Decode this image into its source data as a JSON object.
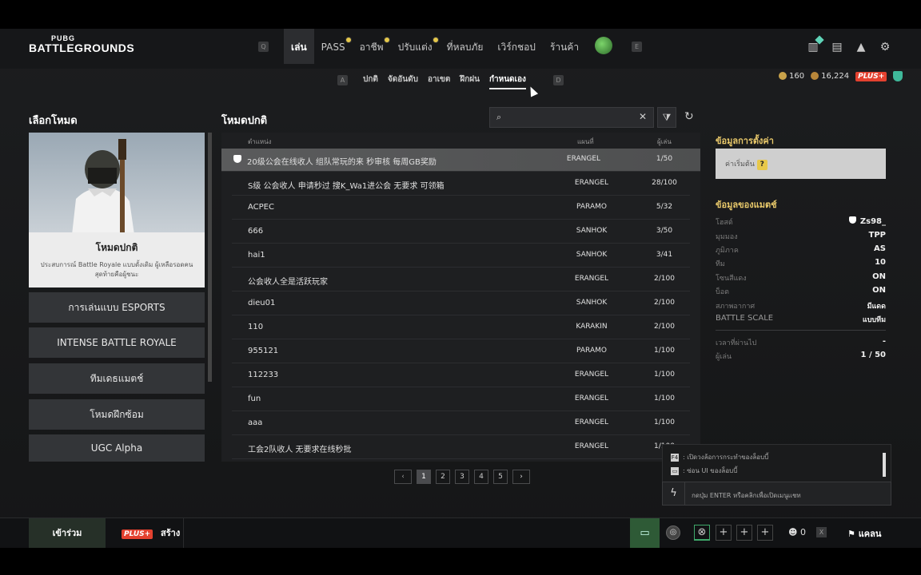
{
  "header": {
    "logo_top": "PUBG",
    "logo_bottom": "BATTLEGROUNDS",
    "key_left": "Q",
    "key_right": "E",
    "nav": [
      {
        "label": "เล่น",
        "active": true,
        "dot": false
      },
      {
        "label": "PASS",
        "active": false,
        "dot": true
      },
      {
        "label": "อาชีพ",
        "active": false,
        "dot": true
      },
      {
        "label": "ปรับแต่ง",
        "active": false,
        "dot": true
      },
      {
        "label": "ที่หลบภัย",
        "active": false,
        "dot": false
      },
      {
        "label": "เวิร์กชอป",
        "active": false,
        "dot": false
      },
      {
        "label": "ร้านค้า",
        "active": false,
        "dot": false
      }
    ],
    "icons": [
      "crate-icon",
      "mail-icon",
      "notification-icon",
      "settings-gear-icon"
    ]
  },
  "subnav": {
    "key_left": "A",
    "key_right": "D",
    "tabs": [
      {
        "label": "ปกติ",
        "active": false
      },
      {
        "label": "จัดอันดับ",
        "active": false
      },
      {
        "label": "อาเขต",
        "active": false
      },
      {
        "label": "ฝึกฝน",
        "active": false
      },
      {
        "label": "กำหนดเอง",
        "active": true
      }
    ]
  },
  "currency": {
    "gcoin": "160",
    "bp": "16,224",
    "plus": "PLUS+"
  },
  "left": {
    "title": "เลือกโหมด",
    "card_title": "โหมดปกติ",
    "card_desc": "ประสบการณ์ Battle Royale แบบดั้งเดิม ผู้เหลือรอดคนสุดท้ายคือผู้ชนะ",
    "modes": [
      "การเล่นแบบ ESPORTS",
      "INTENSE BATTLE ROYALE",
      "ทีมเดธแมตช์",
      "โหมดฝึกซ้อม",
      "UGC Alpha"
    ]
  },
  "list": {
    "title": "โหมดปกติ",
    "search_placeholder": "",
    "col_name": "ตำแหน่ง",
    "col_map": "แผนที่",
    "col_players": "ผู้เล่น",
    "rows": [
      {
        "name": "20级公会在线收人 组队常玩的来 秒审核 每周GB奖励",
        "map": "ERANGEL",
        "players": "1/50",
        "selected": true,
        "locked": true
      },
      {
        "name": "S级 公会收人 申请秒过 搜K_Wa1进公会 无要求 可领箱",
        "map": "ERANGEL",
        "players": "28/100",
        "selected": false,
        "locked": false
      },
      {
        "name": "ACPEC",
        "map": "PARAMO",
        "players": "5/32",
        "selected": false,
        "locked": false
      },
      {
        "name": "666",
        "map": "SANHOK",
        "players": "3/50",
        "selected": false,
        "locked": false
      },
      {
        "name": "hai1",
        "map": "SANHOK",
        "players": "3/41",
        "selected": false,
        "locked": false
      },
      {
        "name": "公会收人全是活跃玩家",
        "map": "ERANGEL",
        "players": "2/100",
        "selected": false,
        "locked": false
      },
      {
        "name": "dieu01",
        "map": "SANHOK",
        "players": "2/100",
        "selected": false,
        "locked": false
      },
      {
        "name": "110",
        "map": "KARAKIN",
        "players": "2/100",
        "selected": false,
        "locked": false
      },
      {
        "name": "955121",
        "map": "PARAMO",
        "players": "1/100",
        "selected": false,
        "locked": false
      },
      {
        "name": "112233",
        "map": "ERANGEL",
        "players": "1/100",
        "selected": false,
        "locked": false
      },
      {
        "name": "fun",
        "map": "ERANGEL",
        "players": "1/100",
        "selected": false,
        "locked": false
      },
      {
        "name": "aaa",
        "map": "ERANGEL",
        "players": "1/100",
        "selected": false,
        "locked": false
      },
      {
        "name": "工会2队收人 无要求在线秒批",
        "map": "ERANGEL",
        "players": "1/100",
        "selected": false,
        "locked": false
      }
    ],
    "pages": [
      "1",
      "2",
      "3",
      "4",
      "5"
    ],
    "current_page": "1"
  },
  "right": {
    "settings_title": "ข้อมูลการตั้งค่า",
    "settings_value": "ค่าเริ่มต้น",
    "settings_help": "?",
    "match_title": "ข้อมูลของแมตช์",
    "info": [
      {
        "k": "โฮสต์",
        "v": "Zs98_"
      },
      {
        "k": "มุมมอง",
        "v": "TPP"
      },
      {
        "k": "ภูมิภาค",
        "v": "AS"
      },
      {
        "k": "ทีม",
        "v": "10"
      },
      {
        "k": "โซนสีแดง",
        "v": "ON"
      },
      {
        "k": "บ็อต",
        "v": "ON"
      },
      {
        "k": "สภาพอากาศ",
        "v": "มีแดด"
      },
      {
        "k": "BATTLE SCALE",
        "v": "แบบทีม"
      }
    ],
    "info2": [
      {
        "k": "เวลาที่ผ่านไป",
        "v": "-"
      },
      {
        "k": "ผู้เล่น",
        "v": "1 / 50"
      }
    ]
  },
  "overlay": {
    "line1_key": "F4",
    "line1": ": เปิดวงล้อการกระทำของล็อบบี้",
    "line2_key": "▭",
    "line2": ": ซ่อน UI ของล็อบบี้",
    "enter_text": "กดปุ่ม ENTER หรือคลิกเพื่อเปิดเมนูแชท"
  },
  "bottom": {
    "join": "เข้าร่วม",
    "create_badge": "PLUS+",
    "create": "สร้าง",
    "friends_count": "0",
    "x_key": "X",
    "clan": "แคลน"
  }
}
